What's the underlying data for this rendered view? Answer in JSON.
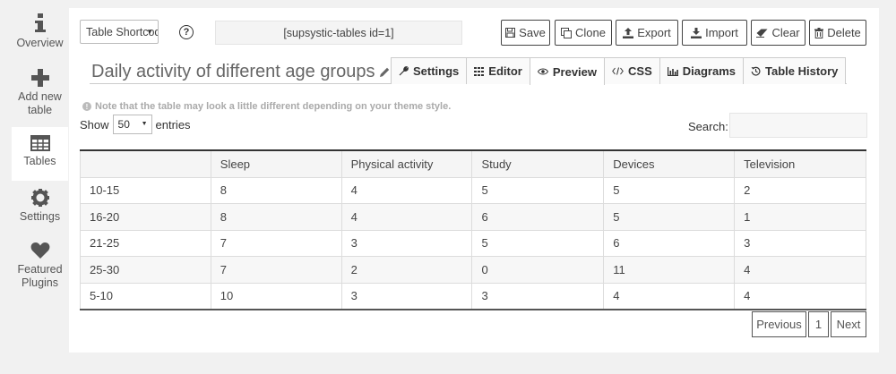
{
  "sidebar": {
    "items": [
      {
        "label": "Overview",
        "icon": "info-icon"
      },
      {
        "label": "Add new table",
        "icon": "plus-icon"
      },
      {
        "label": "Tables",
        "icon": "table-icon",
        "active": true
      },
      {
        "label": "Settings",
        "icon": "gear-icon"
      },
      {
        "label": "Featured Plugins",
        "icon": "heart-icon"
      }
    ]
  },
  "toolbar": {
    "shortcode_select": "Table Shortcode",
    "help_label": "?",
    "shortcode": "[supsystic-tables id=1]",
    "save_label": "Save",
    "clone_label": "Clone",
    "export_label": "Export",
    "import_label": "Import",
    "clear_label": "Clear",
    "delete_label": "Delete"
  },
  "header": {
    "title": "Daily activity of different age groups",
    "tabs": [
      {
        "label": "Settings",
        "icon": "wrench-icon"
      },
      {
        "label": "Editor",
        "icon": "grid-icon"
      },
      {
        "label": "Preview",
        "icon": "eye-icon",
        "active": true
      },
      {
        "label": "CSS",
        "icon": "code-icon"
      },
      {
        "label": "Diagrams",
        "icon": "bar-chart-icon"
      },
      {
        "label": "Table History",
        "icon": "history-icon"
      }
    ]
  },
  "preview": {
    "note": "Note that the table may look a little different depending on your theme style.",
    "show_label": "Show",
    "length_value": "50",
    "entries_label": "entries",
    "search_label": "Search:",
    "columns": [
      "",
      "Sleep",
      "Physical activity",
      "Study",
      "Devices",
      "Television"
    ],
    "rows": [
      [
        "10-15",
        "8",
        "4",
        "5",
        "5",
        "2"
      ],
      [
        "16-20",
        "8",
        "4",
        "6",
        "5",
        "1"
      ],
      [
        "21-25",
        "7",
        "3",
        "5",
        "6",
        "3"
      ],
      [
        "25-30",
        "7",
        "2",
        "0",
        "11",
        "4"
      ],
      [
        "5-10",
        "10",
        "3",
        "3",
        "4",
        "4"
      ]
    ],
    "pagination": {
      "previous": "Previous",
      "page": "1",
      "next": "Next"
    }
  }
}
